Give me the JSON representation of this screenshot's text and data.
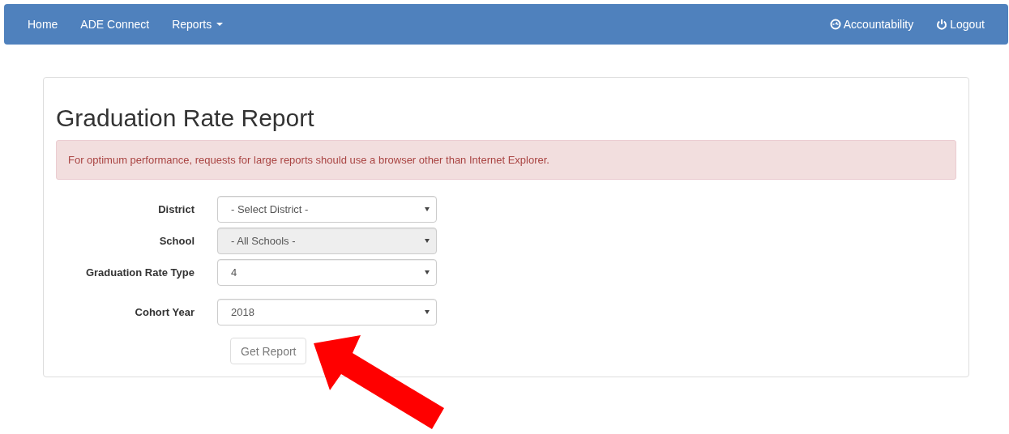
{
  "navbar": {
    "left": [
      {
        "label": "Home",
        "dropdown": false
      },
      {
        "label": "ADE Connect",
        "dropdown": false
      },
      {
        "label": "Reports",
        "dropdown": true
      }
    ],
    "right": [
      {
        "label": "Accountability",
        "kind": "dashboard"
      },
      {
        "label": "Logout",
        "kind": "power"
      }
    ]
  },
  "title": "Graduation Rate Report",
  "alert": "For optimum performance, requests for large reports should use a browser other than Internet Explorer.",
  "fields": [
    {
      "label": "District",
      "value": "- Select District -",
      "disabled": false
    },
    {
      "label": "School",
      "value": "- All Schools -",
      "disabled": true
    },
    {
      "label": "Graduation Rate Type",
      "value": "4",
      "disabled": false
    },
    {
      "label": "Cohort Year",
      "value": "2018",
      "disabled": false
    }
  ],
  "submit": {
    "label": "Get Report",
    "disabled": true
  }
}
